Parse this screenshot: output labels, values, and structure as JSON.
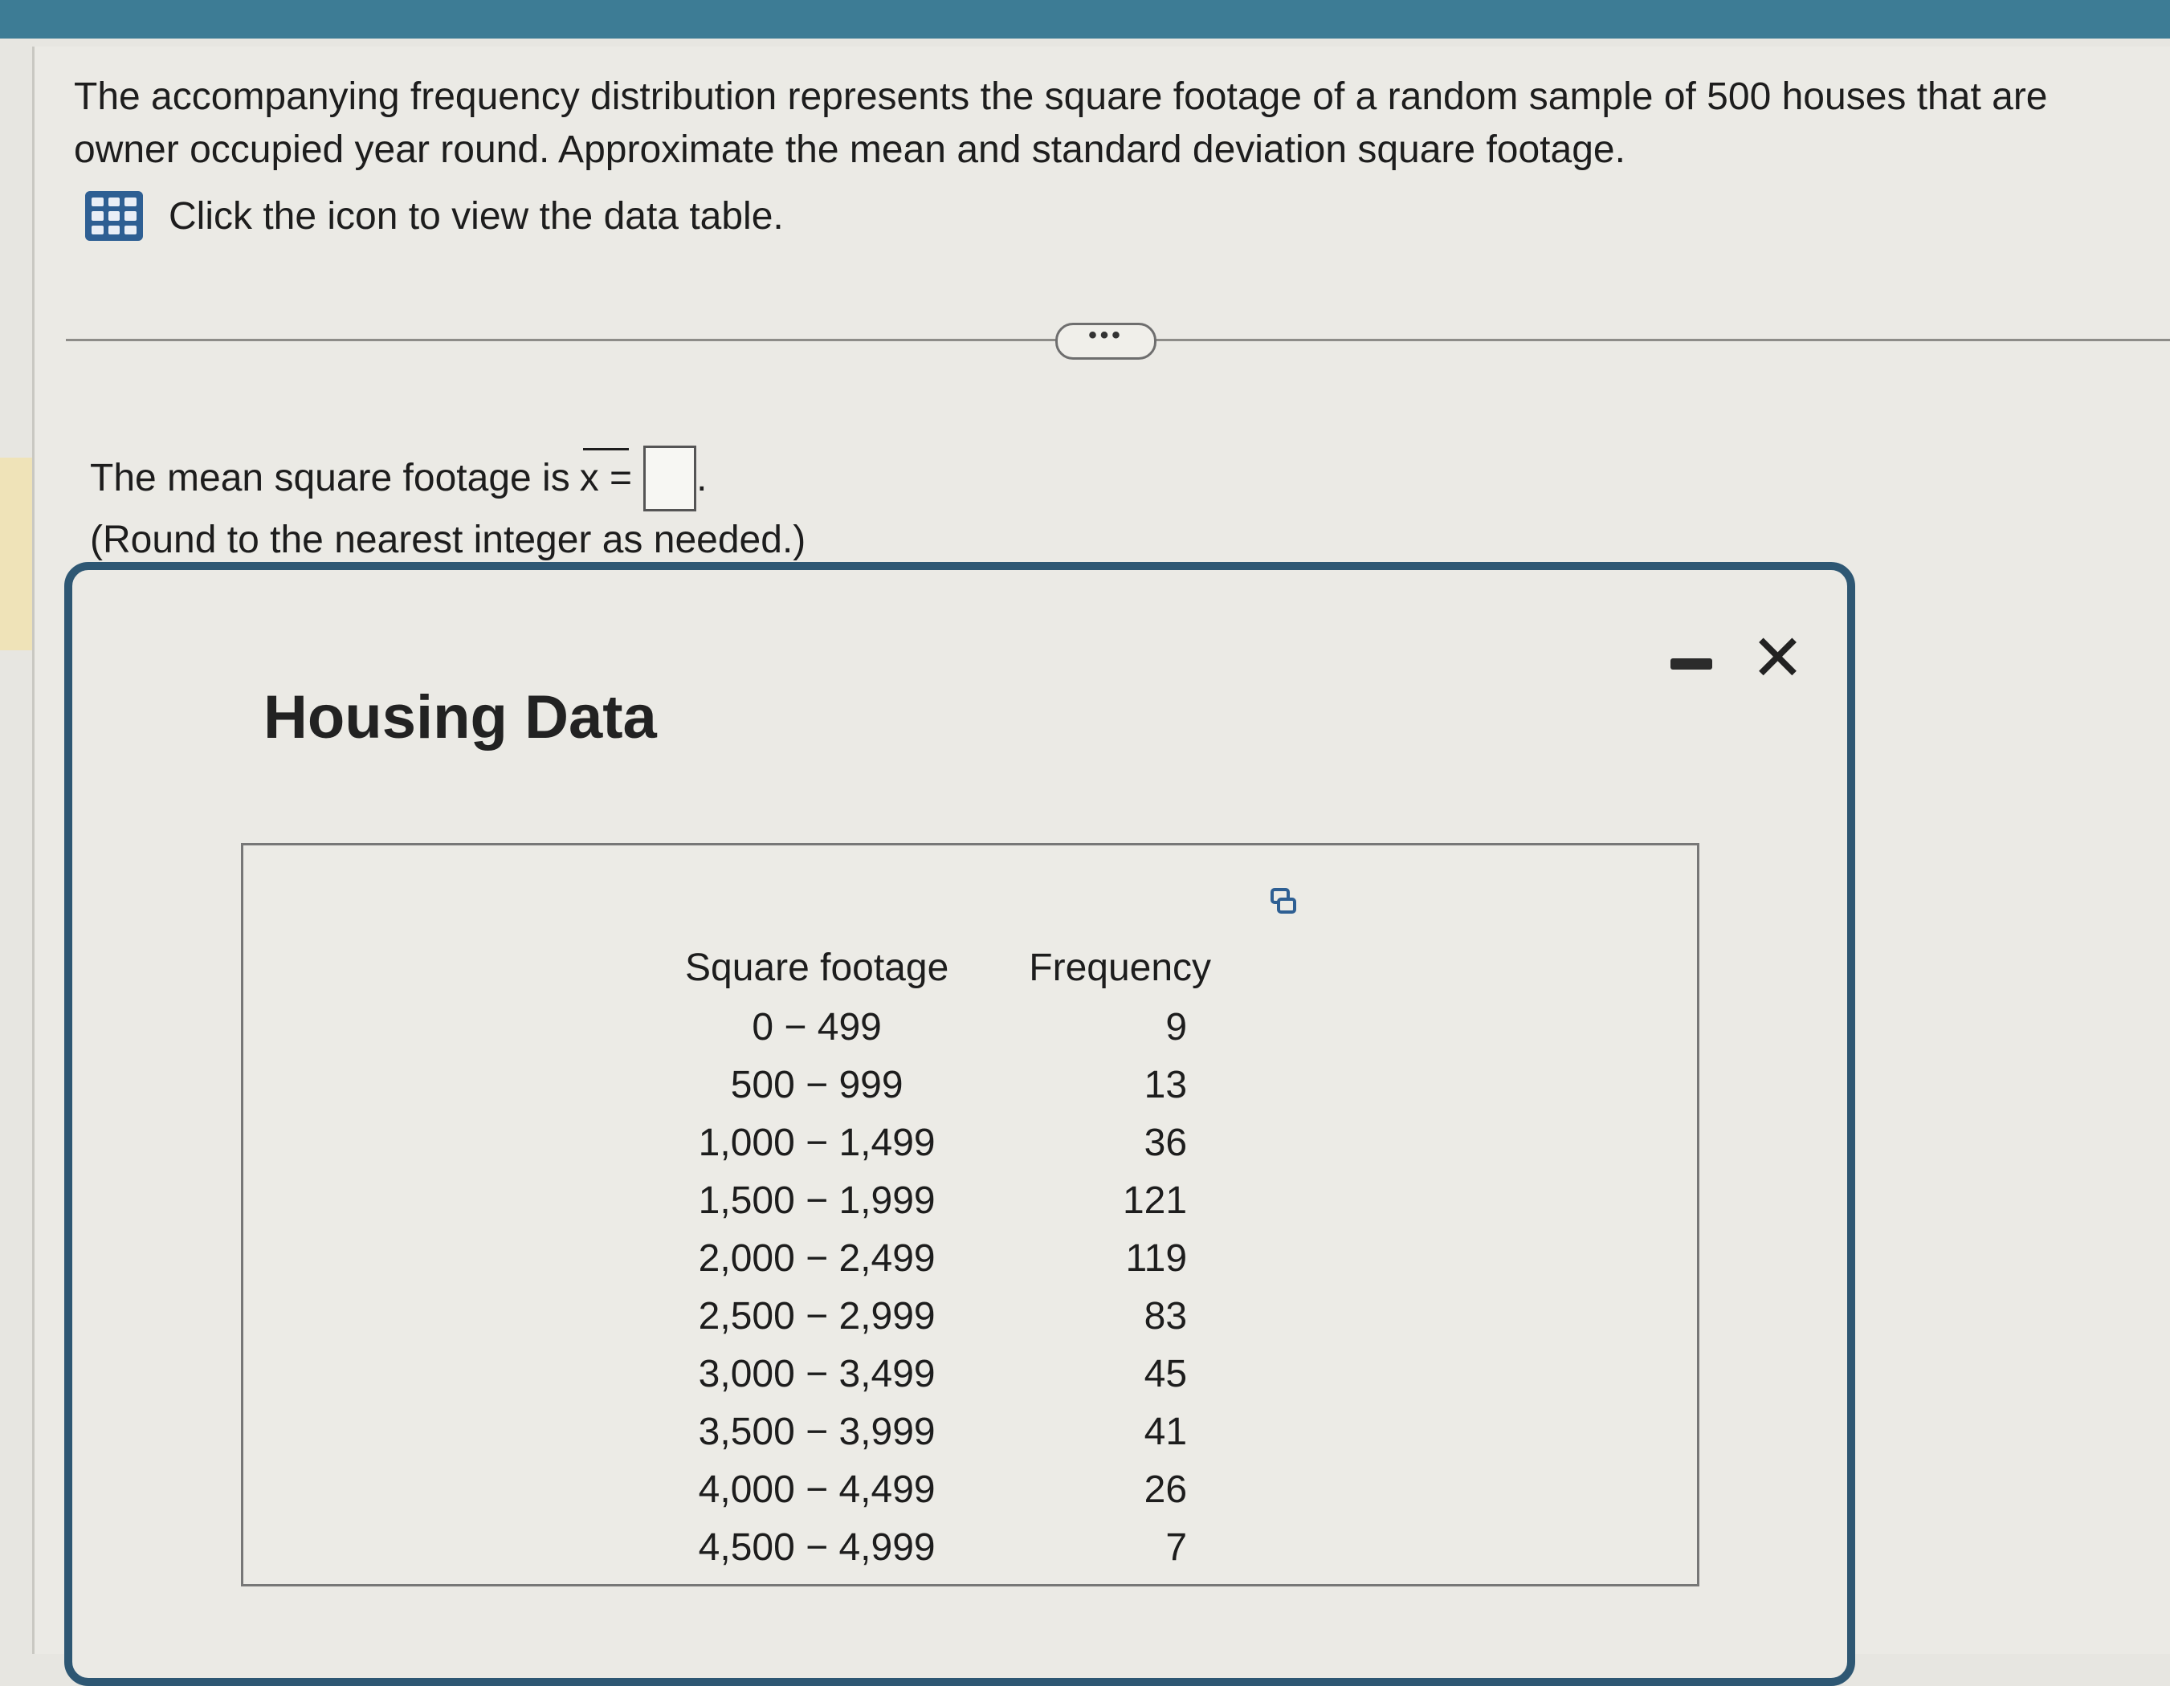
{
  "question": {
    "text": "The accompanying frequency distribution represents the square footage of a random sample of 500 houses that are owner occupied year round. Approximate the mean and standard deviation square footage.",
    "link_text": "Click the icon to view the data table.",
    "link_icon": "table-grid-icon",
    "more_button": "•••"
  },
  "answer": {
    "prompt": "The mean square footage is",
    "symbol": "x =",
    "after_box": ".",
    "hint": "(Round to the nearest integer as needed.)",
    "value": ""
  },
  "modal": {
    "title": "Housing Data",
    "minimize_icon": "minimize-icon",
    "close_label": "✕",
    "copy_icon": "copy-icon"
  },
  "table": {
    "headers": [
      "Square footage",
      "Frequency"
    ],
    "rows": [
      {
        "sqft": "0 − 499",
        "freq": "9"
      },
      {
        "sqft": "500 − 999",
        "freq": "13"
      },
      {
        "sqft": "1,000 − 1,499",
        "freq": "36"
      },
      {
        "sqft": "1,500 − 1,999",
        "freq": "121"
      },
      {
        "sqft": "2,000 − 2,499",
        "freq": "119"
      },
      {
        "sqft": "2,500 − 2,999",
        "freq": "83"
      },
      {
        "sqft": "3,000 − 3,499",
        "freq": "45"
      },
      {
        "sqft": "3,500 − 3,999",
        "freq": "41"
      },
      {
        "sqft": "4,000 − 4,499",
        "freq": "26"
      },
      {
        "sqft": "4,500 − 4,999",
        "freq": "7"
      }
    ]
  },
  "colors": {
    "header_bar": "#3d7c95",
    "modal_border": "#2e5773",
    "icon_blue": "#2e5f93"
  }
}
